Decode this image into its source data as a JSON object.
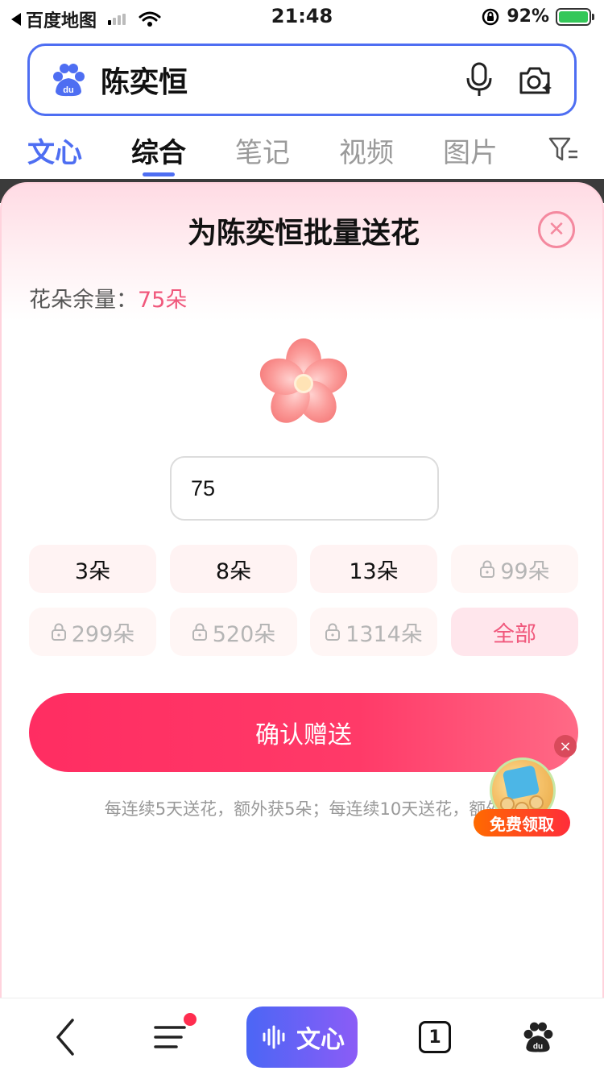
{
  "status_bar": {
    "back_app": "百度地图",
    "time": "21:48",
    "battery": "92%"
  },
  "search": {
    "query": "陈奕恒"
  },
  "tabs": [
    {
      "label": "文心"
    },
    {
      "label": "综合"
    },
    {
      "label": "笔记"
    },
    {
      "label": "视频"
    },
    {
      "label": "图片"
    }
  ],
  "sheet": {
    "title": "为陈奕恒批量送花",
    "remain_label": "花朵余量：",
    "remain_value": "75朵",
    "amount_value": "75",
    "chips": [
      {
        "label": "3朵",
        "locked": false
      },
      {
        "label": "8朵",
        "locked": false
      },
      {
        "label": "13朵",
        "locked": false
      },
      {
        "label": "99朵",
        "locked": true
      },
      {
        "label": "299朵",
        "locked": true
      },
      {
        "label": "520朵",
        "locked": true
      },
      {
        "label": "1314朵",
        "locked": true
      },
      {
        "label": "全部",
        "locked": false
      }
    ],
    "confirm_label": "确认赠送",
    "notice": "每连续5天送花，额外获5朵；每连续10天送花，额外"
  },
  "promo": {
    "label": "免费领取",
    "close": "×"
  },
  "bottom_bar": {
    "wenxin_label": "文心",
    "tab_count": "1"
  },
  "colors": {
    "accent_blue": "#4e6ef2",
    "pink": "#f0587c",
    "confirm_red": "#ff2d62"
  }
}
